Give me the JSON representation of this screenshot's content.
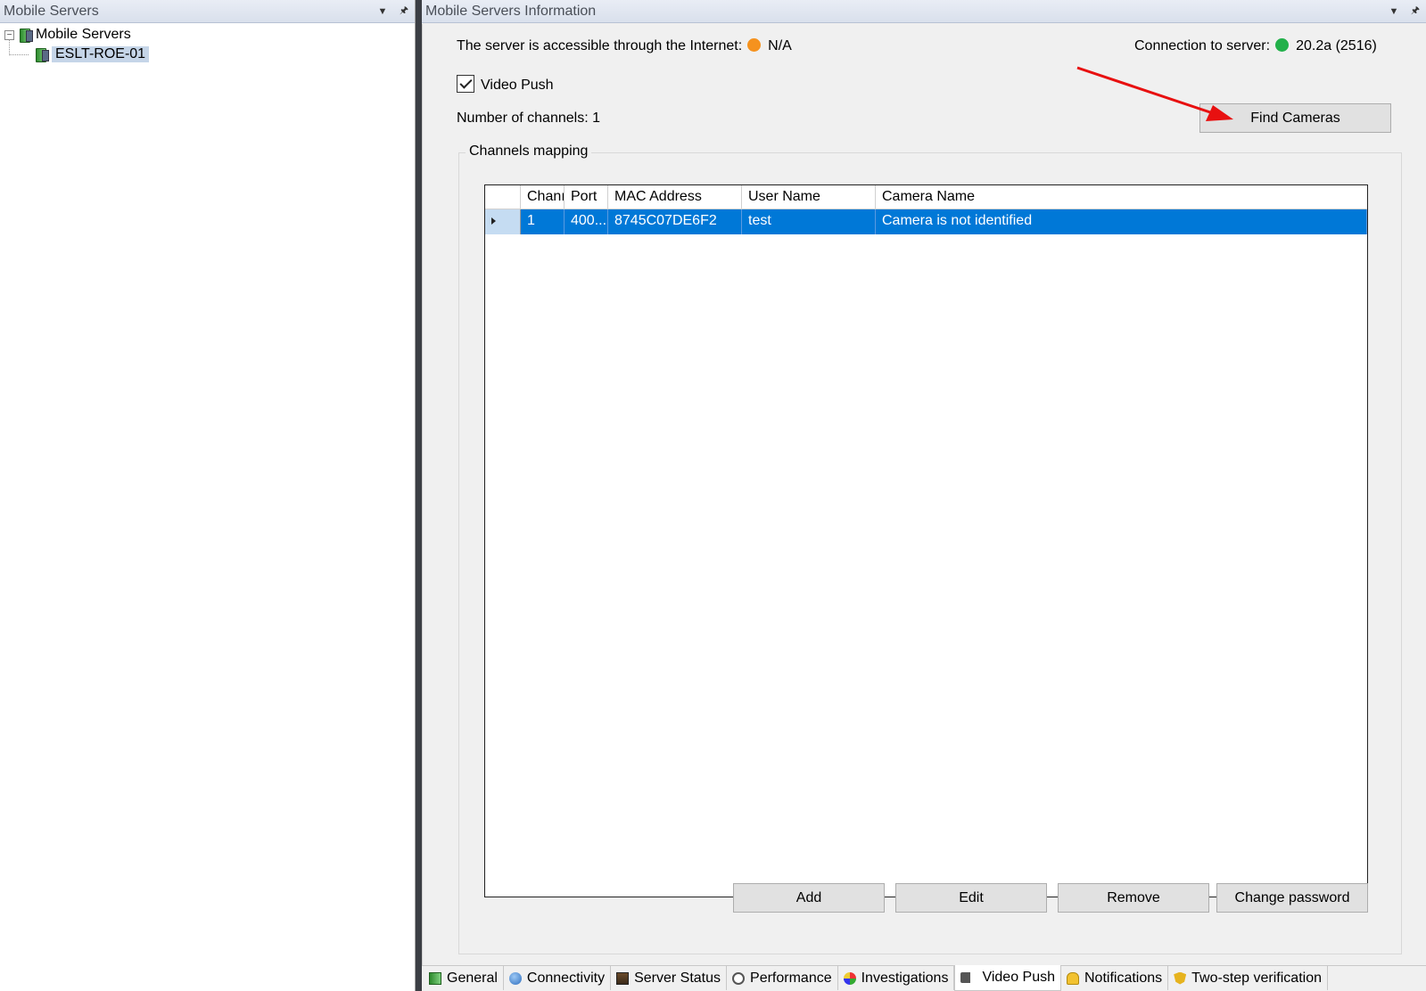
{
  "left_pane": {
    "title": "Mobile Servers",
    "tree": {
      "root_label": "Mobile Servers",
      "toggle": "⊟",
      "child_label": "ESLT-ROE-01"
    }
  },
  "right_pane": {
    "title": "Mobile Servers Information",
    "internet_label": "The server is accessible through the Internet:",
    "internet_value": "N/A",
    "connection_label": "Connection to server:",
    "connection_value": "20.2a (2516)",
    "video_push_label": "Video Push",
    "video_push_checked": true,
    "channels_count_label": "Number of channels: 1",
    "find_cameras_button": "Find Cameras",
    "channels_group_label": "Channels mapping",
    "grid": {
      "columns": [
        "Chanı",
        "Port",
        "MAC Address",
        "User Name",
        "Camera Name"
      ],
      "rows": [
        [
          "1",
          "400...",
          "8745C07DE6F2",
          "test",
          "Camera is not identified"
        ]
      ]
    },
    "buttons": {
      "add": "Add",
      "edit": "Edit",
      "remove": "Remove",
      "change_password": "Change password"
    },
    "tabs": [
      {
        "label": "General",
        "icon": "general-icon"
      },
      {
        "label": "Connectivity",
        "icon": "globe-icon"
      },
      {
        "label": "Server Status",
        "icon": "status-icon"
      },
      {
        "label": "Performance",
        "icon": "gauge-icon"
      },
      {
        "label": "Investigations",
        "icon": "investigations-icon"
      },
      {
        "label": "Video Push",
        "icon": "camera-icon",
        "active": true
      },
      {
        "label": "Notifications",
        "icon": "bell-icon"
      },
      {
        "label": "Two-step verification",
        "icon": "shield-icon"
      }
    ]
  },
  "colors": {
    "status_orange": "#f5921e",
    "status_green": "#22b04a",
    "selection_blue": "#0078d7",
    "annotation_red": "#e81010"
  }
}
